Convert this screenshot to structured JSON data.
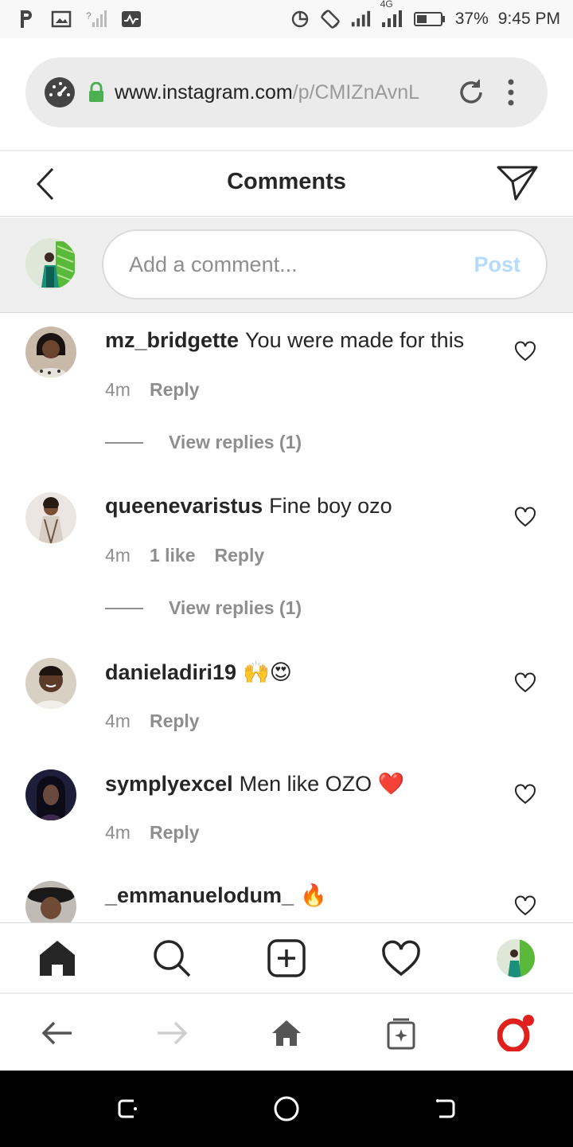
{
  "status_bar": {
    "left_icons": [
      "parking-icon",
      "image-icon",
      "no-signal-icon",
      "activity-icon"
    ],
    "network_type": "4G",
    "battery_percent": "37%",
    "time": "9:45 PM"
  },
  "browser": {
    "url_host": "www.instagram.com",
    "url_path": "/p/CMIZnAvnL"
  },
  "header": {
    "title": "Comments"
  },
  "add_comment": {
    "placeholder": "Add a comment...",
    "post_label": "Post"
  },
  "comments": [
    {
      "username": "mz_bridgette",
      "text": "You were made for this",
      "time": "4m",
      "likes": "",
      "reply_label": "Reply",
      "view_replies": "View replies (1)"
    },
    {
      "username": "queenevaristus",
      "text": "Fine boy ozo",
      "time": "4m",
      "likes": "1 like",
      "reply_label": "Reply",
      "view_replies": "View replies (1)"
    },
    {
      "username": "danieladiri19",
      "text": "🙌😍",
      "time": "4m",
      "likes": "",
      "reply_label": "Reply",
      "view_replies": ""
    },
    {
      "username": "symplyexcel",
      "text": "Men like OZO ❤️",
      "time": "4m",
      "likes": "",
      "reply_label": "Reply",
      "view_replies": ""
    },
    {
      "username": "_emmanuelodum_",
      "text": "🔥",
      "time": "",
      "likes": "",
      "reply_label": "",
      "view_replies": ""
    }
  ],
  "colors": {
    "post_disabled": "#b3dbff",
    "secondary_text": "#8e8e8e",
    "primary_text": "#262626",
    "opera_red": "#e0201d"
  }
}
